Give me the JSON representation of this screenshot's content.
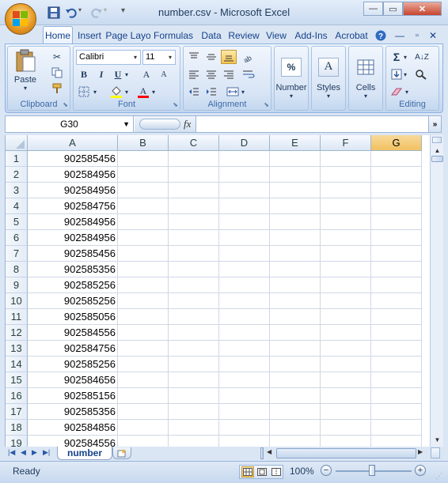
{
  "window": {
    "title": "number.csv - Microsoft Excel",
    "minimize": "—",
    "maximize": "▭",
    "close": "✕"
  },
  "tabs": [
    "Home",
    "Insert",
    "Page Layo",
    "Formulas",
    "Data",
    "Review",
    "View",
    "Add-Ins",
    "Acrobat"
  ],
  "ribbon": {
    "clipboard": {
      "paste_label": "Paste",
      "group_label": "Clipboard"
    },
    "font": {
      "font_name": "Calibri",
      "font_size": "11",
      "bold": "B",
      "italic": "I",
      "underline": "U",
      "grow": "A",
      "shrink": "A",
      "font_color": "A",
      "group_label": "Font"
    },
    "alignment": {
      "group_label": "Alignment"
    },
    "number": {
      "label": "Number",
      "icon": "%"
    },
    "styles": {
      "label": "Styles",
      "icon": "A"
    },
    "cells": {
      "label": "Cells"
    },
    "editing": {
      "group_label": "Editing",
      "sum": "Σ",
      "sort": "A↓Z",
      "find": "A"
    }
  },
  "formula_bar": {
    "name_box": "G30",
    "fx": "fx",
    "formula": ""
  },
  "columns": [
    "A",
    "B",
    "C",
    "D",
    "E",
    "F",
    "G"
  ],
  "selected_column": "G",
  "rows": [
    {
      "n": "1",
      "a": "902585456"
    },
    {
      "n": "2",
      "a": "902584956"
    },
    {
      "n": "3",
      "a": "902584956"
    },
    {
      "n": "4",
      "a": "902584756"
    },
    {
      "n": "5",
      "a": "902584956"
    },
    {
      "n": "6",
      "a": "902584956"
    },
    {
      "n": "7",
      "a": "902585456"
    },
    {
      "n": "8",
      "a": "902585356"
    },
    {
      "n": "9",
      "a": "902585256"
    },
    {
      "n": "10",
      "a": "902585256"
    },
    {
      "n": "11",
      "a": "902585056"
    },
    {
      "n": "12",
      "a": "902584556"
    },
    {
      "n": "13",
      "a": "902584756"
    },
    {
      "n": "14",
      "a": "902585256"
    },
    {
      "n": "15",
      "a": "902584656"
    },
    {
      "n": "16",
      "a": "902585156"
    },
    {
      "n": "17",
      "a": "902585356"
    },
    {
      "n": "18",
      "a": "902584856"
    },
    {
      "n": "19",
      "a": "902584556"
    }
  ],
  "sheet_tab": "number",
  "status": {
    "text": "Ready",
    "zoom": "100%"
  },
  "colors": {
    "accent": "#15428b",
    "selected_header": "#f1c15f",
    "ribbon": "#d4e2f4"
  }
}
